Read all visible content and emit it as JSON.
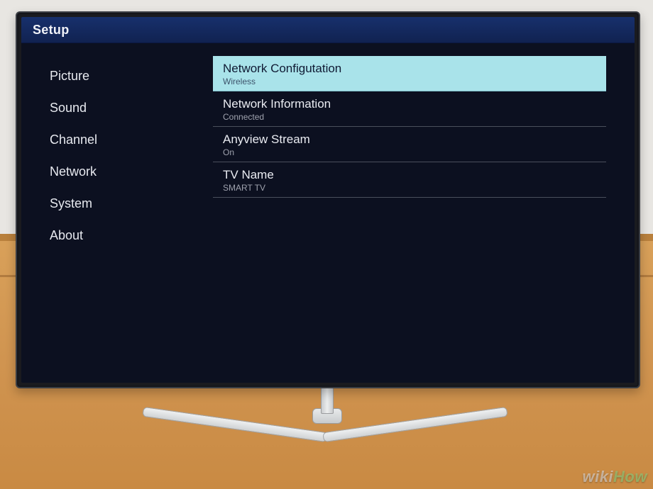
{
  "header": {
    "title": "Setup"
  },
  "sidebar": {
    "items": [
      {
        "label": "Picture"
      },
      {
        "label": "Sound"
      },
      {
        "label": "Channel"
      },
      {
        "label": "Network"
      },
      {
        "label": "System"
      },
      {
        "label": "About"
      }
    ]
  },
  "panel": {
    "rows": [
      {
        "label": "Network Configutation",
        "value": "Wireless",
        "selected": true
      },
      {
        "label": "Network Information",
        "value": "Connected",
        "selected": false
      },
      {
        "label": "Anyview Stream",
        "value": "On",
        "selected": false
      },
      {
        "label": "TV Name",
        "value": "SMART TV",
        "selected": false
      }
    ]
  },
  "watermark": {
    "wiki": "wiki",
    "how": "How"
  }
}
